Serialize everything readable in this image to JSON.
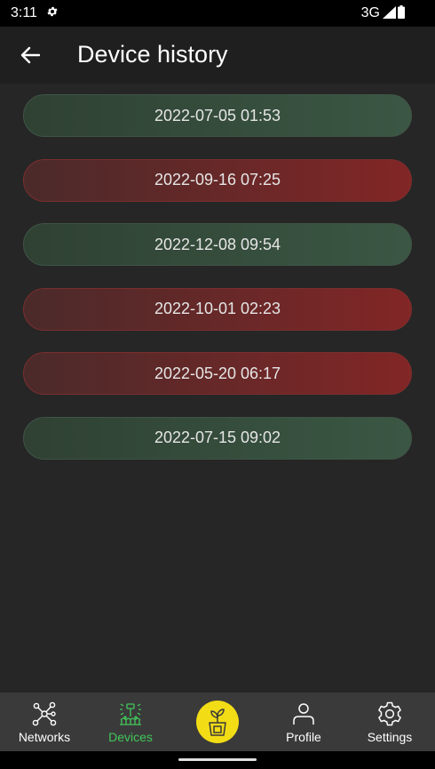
{
  "status_bar": {
    "time": "3:11",
    "network": "3G",
    "icons": [
      "gear-icon",
      "signal-icon",
      "battery-icon"
    ]
  },
  "app_bar": {
    "title": "Device history",
    "back_icon": "arrow-left-icon"
  },
  "history": [
    {
      "timestamp": "2022-07-05 01:53",
      "status": "ok"
    },
    {
      "timestamp": "2022-09-16 07:25",
      "status": "fail"
    },
    {
      "timestamp": "2022-12-08 09:54",
      "status": "ok"
    },
    {
      "timestamp": "2022-10-01 02:23",
      "status": "fail"
    },
    {
      "timestamp": "2022-05-20 06:17",
      "status": "fail"
    },
    {
      "timestamp": "2022-07-15 09:02",
      "status": "ok"
    }
  ],
  "colors": {
    "ok": "#3b5744",
    "fail": "#822626",
    "active_nav": "#41c85a",
    "fab": "#f2dc16",
    "background": "#262626"
  },
  "bottom_nav": {
    "networks": {
      "label": "Networks",
      "icon": "network-icon"
    },
    "devices": {
      "label": "Devices",
      "icon": "sprinkler-icon",
      "active": true
    },
    "center": {
      "icon": "plant-pot-icon"
    },
    "profile": {
      "label": "Profile",
      "icon": "person-icon"
    },
    "settings": {
      "label": "Settings",
      "icon": "gear-icon"
    }
  }
}
